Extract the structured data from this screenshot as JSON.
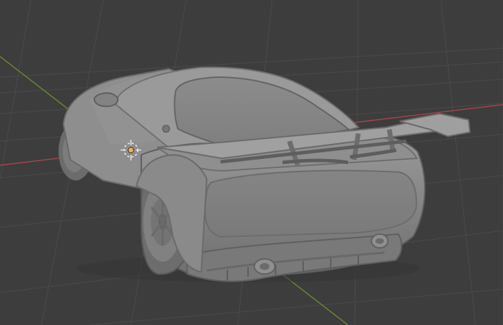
{
  "viewport": {
    "background": "#3d3d3d",
    "grid_color": "#4a4a4a",
    "x_axis_color": "#a8454b",
    "y_axis_color": "#6a8f2f",
    "model_base_color": "#8a8a8a",
    "model_shadow_color": "#5d5d5d",
    "model_highlight_color": "#a8a8a8",
    "origin_icon": "origin-icon"
  }
}
